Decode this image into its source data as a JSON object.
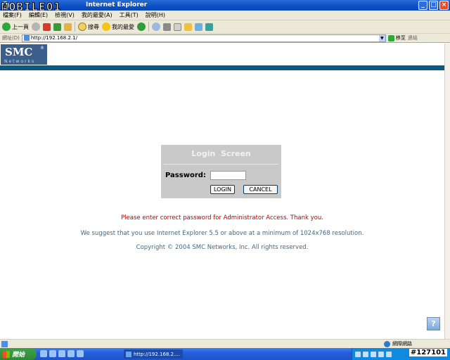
{
  "window": {
    "title": "Internet Explorer",
    "watermark": "MOBILE01"
  },
  "menu": [
    "檔案(F)",
    "編輯(E)",
    "檢視(V)",
    "我的最愛(A)",
    "工具(T)",
    "說明(H)"
  ],
  "toolbar": {
    "back_label": "上一頁",
    "search_label": "搜尋",
    "favorites_label": "我的最愛"
  },
  "address": {
    "label": "網址(D)",
    "url": "http://192.168.2.1/",
    "go_label": "移至",
    "links_label": "連結"
  },
  "logo": {
    "brand": "SMC",
    "reg": "®",
    "sub": "Networks"
  },
  "login": {
    "title": "Login Screen",
    "password_label": "Password:",
    "password_value": "",
    "login_button": "LOGIN",
    "cancel_button": "CANCEL"
  },
  "messages": {
    "error": "Please enter correct password for Administrator Access. Thank you.",
    "suggest": "We suggest that you use Internet Explorer 5.5 or above at a minimum of 1024x768 resolution.",
    "copyright": "Copyright © 2004 SMC Networks, Inc. All rights reserved."
  },
  "help_label": "?",
  "statusbar": {
    "zone": "網際網路"
  },
  "taskbar": {
    "start_label": "開始",
    "task_label": "http://192.168.2....",
    "clock": "#127101"
  },
  "colors": {
    "band": "#0a5a86",
    "error": "#c00000",
    "info": "#3a6a8f",
    "login_box": "#c9c9c9"
  }
}
